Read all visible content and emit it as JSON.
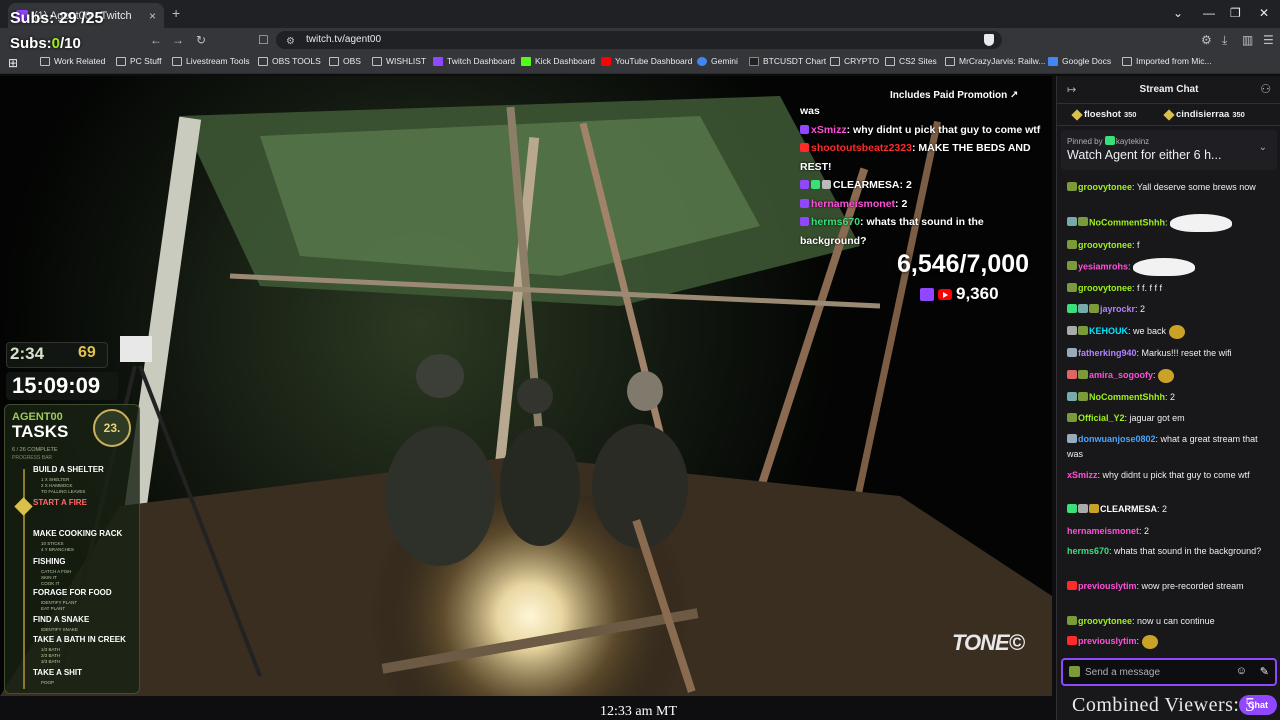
{
  "browser": {
    "tab_title": "(1) Agent00 - Twitch",
    "tab_close": "×",
    "new_tab": "+",
    "url": "twitch.tv/agent00",
    "window_controls": [
      "⌄",
      "—",
      "❐",
      "✕"
    ]
  },
  "bookmarks": [
    {
      "label": "Work Related",
      "icon": "folder"
    },
    {
      "label": "PC Stuff",
      "icon": "folder"
    },
    {
      "label": "Livestream Tools",
      "icon": "folder"
    },
    {
      "label": "OBS TOOLS",
      "icon": "folder"
    },
    {
      "label": "OBS",
      "icon": "folder"
    },
    {
      "label": "WISHLIST",
      "icon": "folder"
    },
    {
      "label": "Twitch Dashboard",
      "icon": "twitch"
    },
    {
      "label": "Kick Dashboard",
      "icon": "kick"
    },
    {
      "label": "YouTube Dashboard",
      "icon": "youtube"
    },
    {
      "label": "Gemini",
      "icon": "gemini"
    },
    {
      "label": "BTCUSDT Chart",
      "icon": "chart"
    },
    {
      "label": "CRYPTO",
      "icon": "folder"
    },
    {
      "label": "CS2 Sites",
      "icon": "folder"
    },
    {
      "label": "MrCrazyJarvis: Railw...",
      "icon": "folder"
    },
    {
      "label": "Google Docs",
      "icon": "docs"
    },
    {
      "label": "Imported from Mic...",
      "icon": "folder"
    }
  ],
  "subs": {
    "line1": "Subs: 29 /25",
    "line2_label": "Subs:",
    "line2_value": "0",
    "line2_total": "/10"
  },
  "video": {
    "promo": "Includes Paid Promotion",
    "goal": "6,546/7,000",
    "views": "9,360",
    "brand": "TONE",
    "timer": "2:34",
    "timer_num": "69",
    "clock": "15:09:09",
    "caption": "12:33 am MT"
  },
  "overlay_chat": [
    {
      "user": "",
      "text": "was"
    },
    {
      "user": "xSmizz",
      "text": "why didnt u pick that guy to come wtf"
    },
    {
      "user": "shootoutsbeatz2323",
      "text": "MAKE THE BEDS AND REST!"
    },
    {
      "user": "CLEARMESA",
      "text": "2"
    },
    {
      "user": "hernameismonet",
      "text": "2"
    },
    {
      "user": "herms670",
      "text": "whats that sound in the background?"
    }
  ],
  "tasks": {
    "agent": "AGENT00",
    "title": "TASKS",
    "count": "23.",
    "progress": "6 / 26 COMPLETE",
    "progress_bar": "PROGRESS BAR",
    "items": [
      {
        "name": "BUILD A SHELTER",
        "subs": [
          "1 X SHELTER",
          "2 X HAMMOCK",
          "TO FALLING LEAVES"
        ],
        "done": false
      },
      {
        "name": "START A FIRE",
        "subs": [
          "",
          "",
          ""
        ],
        "done": true
      },
      {
        "name": "MAKE COOKING RACK",
        "subs": [
          "10 STICKS",
          "4 Y BRANCHES"
        ],
        "done": false
      },
      {
        "name": "FISHING",
        "subs": [
          "CATCH A FISH",
          "SKIN IT",
          "COOK IT"
        ],
        "done": false
      },
      {
        "name": "FORAGE FOR FOOD",
        "subs": [
          "IDENTIFY PLANT",
          "EAT PLANT"
        ],
        "done": false
      },
      {
        "name": "FIND A SNAKE",
        "subs": [
          "IDENTIFY SNAKE"
        ],
        "done": false
      },
      {
        "name": "TAKE A BATH IN CREEK",
        "subs": [
          "1/3 BATH",
          "2/3 BATH",
          "3/3 BATH"
        ],
        "done": false
      },
      {
        "name": "TAKE A SHIT",
        "subs": [
          "POOP"
        ],
        "done": false
      }
    ]
  },
  "chat": {
    "title": "Stream Chat",
    "collapse_icon": "↦",
    "users_icon": "⚇",
    "gifters": [
      {
        "name": "floeshot",
        "amount": "350"
      },
      {
        "name": "cindisierraa",
        "amount": "350"
      }
    ],
    "pinned_by": "Pinned by",
    "pinned_user": "kaytekinz",
    "pinned_message": "Watch Agent for either 6 h...",
    "messages": [
      {
        "user": "groovytonee",
        "color": "#9ef01a",
        "text": "Yall deserve some brews now"
      },
      {
        "user": "NoCommentShhh",
        "color": "#9ef01a",
        "text": "",
        "emote": "cloud"
      },
      {
        "user": "groovytonee",
        "color": "#9ef01a",
        "text": "f"
      },
      {
        "user": "yesiamrohs",
        "color": "#ff4fd8",
        "text": "",
        "emote": "cloud"
      },
      {
        "user": "groovytonee",
        "color": "#9ef01a",
        "text": "f f. f f f"
      },
      {
        "user": "jayrockr",
        "color": "#b281ff",
        "text": "2"
      },
      {
        "user": "KEHOUK",
        "color": "#00e5ff",
        "text": "we back",
        "emote": "face"
      },
      {
        "user": "fatherking940",
        "color": "#b281ff",
        "text": "Markus!!! reset the wifi"
      },
      {
        "user": "amira_sogoofy",
        "color": "#ff4fd8",
        "text": "",
        "emote": "face"
      },
      {
        "user": "NoCommentShhh",
        "color": "#9ef01a",
        "text": "2"
      },
      {
        "user": "Official_Y2",
        "color": "#9ef01a",
        "text": "jaguar got em"
      },
      {
        "user": "donwuanjose0802",
        "color": "#4aa3ff",
        "text": "what a great stream that was"
      },
      {
        "user": "xSmizz",
        "color": "#ff4fd8",
        "text": "why didnt u pick that guy to come wtf"
      },
      {
        "user": "CLEARMESA",
        "color": "#ffffff",
        "text": "2"
      },
      {
        "user": "hernameismonet",
        "color": "#ff4fd8",
        "text": "2"
      },
      {
        "user": "herms670",
        "color": "#39e07a",
        "text": "whats that sound in the background?"
      },
      {
        "user": "previouslytim",
        "color": "#ff4fd8",
        "text": "wow pre-recorded stream"
      },
      {
        "user": "groovytonee",
        "color": "#9ef01a",
        "text": "now u can continue"
      },
      {
        "user": "previouslytim",
        "color": "#ff4fd8",
        "text": "",
        "emote": "face"
      }
    ],
    "input_placeholder": "Send a message",
    "chat_button": "Chat",
    "combined_viewers": "Combined Viewers: 5"
  }
}
